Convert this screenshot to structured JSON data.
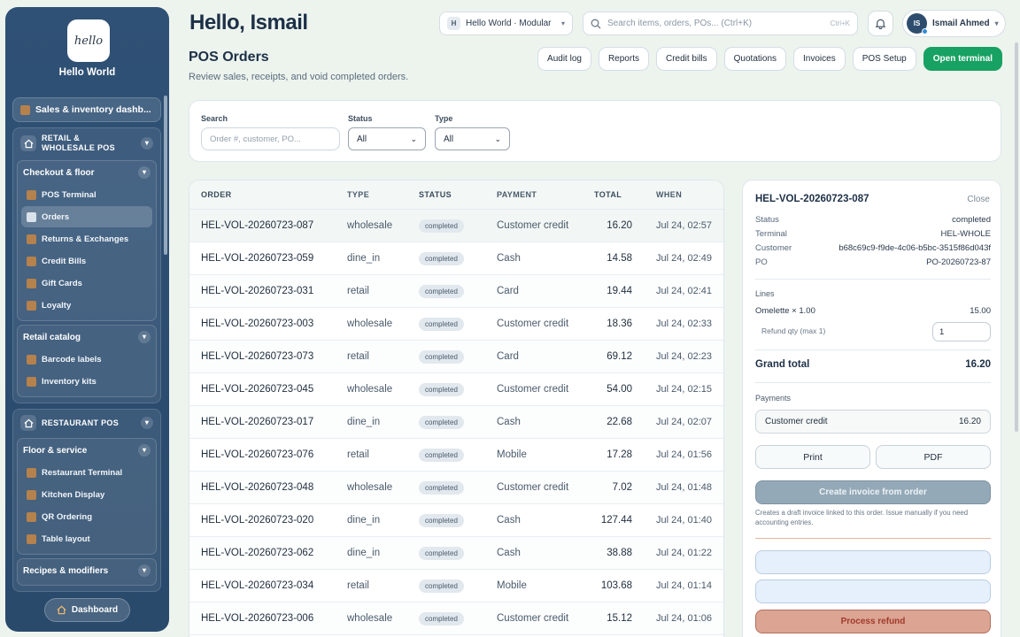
{
  "brand": {
    "logo_text": "hello",
    "name": "Hello World"
  },
  "sidebar": {
    "dashboard_link": "Sales & inventory dashb...",
    "groups": [
      {
        "title": "RETAIL & WHOLESALE POS",
        "sections": [
          {
            "title": "Checkout & floor",
            "items": [
              "POS Terminal",
              "Orders",
              "Returns & Exchanges",
              "Credit Bills",
              "Gift Cards",
              "Loyalty"
            ]
          },
          {
            "title": "Retail catalog",
            "items": [
              "Barcode labels",
              "Inventory kits"
            ]
          }
        ]
      },
      {
        "title": "RESTAURANT POS",
        "sections": [
          {
            "title": "Floor & service",
            "items": [
              "Restaurant Terminal",
              "Kitchen Display",
              "QR Ordering",
              "Table layout"
            ]
          },
          {
            "title": "Recipes & modifiers",
            "items": []
          }
        ]
      }
    ],
    "footer_button": "Dashboard"
  },
  "header": {
    "greeting": "Hello, Ismail",
    "workspace": {
      "badge": "H",
      "label": "Hello World · Modular"
    },
    "search_placeholder": "Search items, orders, POs... (Ctrl+K)",
    "search_shortcut": "Ctrl+K",
    "user": {
      "initials": "IS",
      "name": "Ismail Ahmed"
    }
  },
  "page": {
    "title": "POS Orders",
    "subtitle": "Review sales, receipts, and void completed orders.",
    "actions": [
      "Audit log",
      "Reports",
      "Credit bills",
      "Quotations",
      "Invoices",
      "POS Setup"
    ],
    "primary_action": "Open terminal"
  },
  "filters": {
    "search_label": "Search",
    "search_placeholder": "Order #, customer, PO...",
    "status_label": "Status",
    "status_value": "All",
    "type_label": "Type",
    "type_value": "All"
  },
  "table": {
    "columns": [
      "ORDER",
      "TYPE",
      "STATUS",
      "PAYMENT",
      "TOTAL",
      "WHEN"
    ],
    "rows": [
      {
        "order": "HEL-VOL-20260723-087",
        "type": "wholesale",
        "status": "completed",
        "payment": "Customer credit",
        "total": "16.20",
        "when": "Jul 24, 02:57"
      },
      {
        "order": "HEL-VOL-20260723-059",
        "type": "dine_in",
        "status": "completed",
        "payment": "Cash",
        "total": "14.58",
        "when": "Jul 24, 02:49"
      },
      {
        "order": "HEL-VOL-20260723-031",
        "type": "retail",
        "status": "completed",
        "payment": "Card",
        "total": "19.44",
        "when": "Jul 24, 02:41"
      },
      {
        "order": "HEL-VOL-20260723-003",
        "type": "wholesale",
        "status": "completed",
        "payment": "Customer credit",
        "total": "18.36",
        "when": "Jul 24, 02:33"
      },
      {
        "order": "HEL-VOL-20260723-073",
        "type": "retail",
        "status": "completed",
        "payment": "Card",
        "total": "69.12",
        "when": "Jul 24, 02:23"
      },
      {
        "order": "HEL-VOL-20260723-045",
        "type": "wholesale",
        "status": "completed",
        "payment": "Customer credit",
        "total": "54.00",
        "when": "Jul 24, 02:15"
      },
      {
        "order": "HEL-VOL-20260723-017",
        "type": "dine_in",
        "status": "completed",
        "payment": "Cash",
        "total": "22.68",
        "when": "Jul 24, 02:07"
      },
      {
        "order": "HEL-VOL-20260723-076",
        "type": "retail",
        "status": "completed",
        "payment": "Mobile",
        "total": "17.28",
        "when": "Jul 24, 01:56"
      },
      {
        "order": "HEL-VOL-20260723-048",
        "type": "wholesale",
        "status": "completed",
        "payment": "Customer credit",
        "total": "7.02",
        "when": "Jul 24, 01:48"
      },
      {
        "order": "HEL-VOL-20260723-020",
        "type": "dine_in",
        "status": "completed",
        "payment": "Cash",
        "total": "127.44",
        "when": "Jul 24, 01:40"
      },
      {
        "order": "HEL-VOL-20260723-062",
        "type": "dine_in",
        "status": "completed",
        "payment": "Cash",
        "total": "38.88",
        "when": "Jul 24, 01:22"
      },
      {
        "order": "HEL-VOL-20260723-034",
        "type": "retail",
        "status": "completed",
        "payment": "Mobile",
        "total": "103.68",
        "when": "Jul 24, 01:14"
      },
      {
        "order": "HEL-VOL-20260723-006",
        "type": "wholesale",
        "status": "completed",
        "payment": "Customer credit",
        "total": "15.12",
        "when": "Jul 24, 01:06"
      }
    ]
  },
  "detail": {
    "title": "HEL-VOL-20260723-087",
    "close_label": "Close",
    "fields": [
      {
        "k": "Status",
        "v": "completed"
      },
      {
        "k": "Terminal",
        "v": "HEL-WHOLE"
      },
      {
        "k": "Customer",
        "v": "b68c69c9-f9de-4c06-b5bc-3515f86d043f"
      },
      {
        "k": "PO",
        "v": "PO-20260723-87"
      }
    ],
    "lines_label": "Lines",
    "line_item": {
      "name": "Omelette × 1.00",
      "amount": "15.00"
    },
    "refund_label": "Refund qty (max 1)",
    "refund_value": "1",
    "grand_total_label": "Grand total",
    "grand_total": "16.20",
    "payments_label": "Payments",
    "payment": {
      "method": "Customer credit",
      "amount": "16.20"
    },
    "print_label": "Print",
    "pdf_label": "PDF",
    "invoice_label": "Create invoice from order",
    "invoice_note": "Creates a draft invoice linked to this order. Issue manually if you need accounting entries.",
    "refund_button": "Process refund"
  },
  "colors": {
    "primary": "#17a162",
    "sidebar": "#2e4f73",
    "refund": "#dba493"
  }
}
